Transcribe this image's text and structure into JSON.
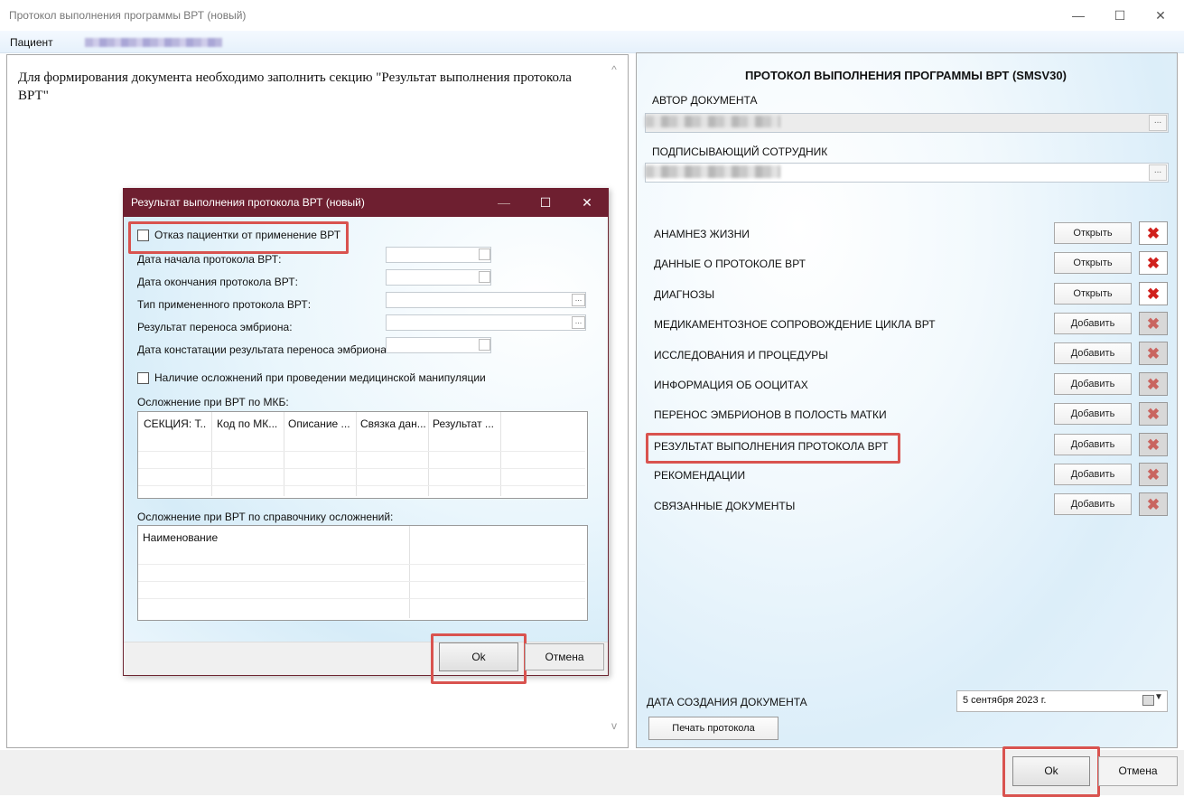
{
  "window": {
    "title": "Протокол выполнения программы ВРТ (новый)",
    "controls": {
      "minimize": "—",
      "maximize": "☐",
      "close": "✕"
    }
  },
  "patient": {
    "label": "Пациент"
  },
  "left": {
    "message": "Для формирования документа необходимо заполнить секцию \"Результат выполнения протокола ВРТ\"",
    "scroll_up": "^",
    "scroll_down": "v"
  },
  "right": {
    "doc_title": "ПРОТОКОЛ ВЫПОЛНЕНИЯ ПРОГРАММЫ ВРТ (SMSV30)",
    "author_label": "АВТОР ДОКУМЕНТА",
    "signer_label": "ПОДПИСЫВАЮЩИЙ СОТРУДНИК",
    "ellipsis": "...",
    "sections": [
      {
        "label": "АНАМНЕЗ ЖИЗНИ",
        "button": "Открыть"
      },
      {
        "label": "ДАННЫЕ О ПРОТОКОЛЕ ВРТ",
        "button": "Открыть"
      },
      {
        "label": "ДИАГНОЗЫ",
        "button": "Открыть"
      },
      {
        "label": "МЕДИКАМЕНТОЗНОЕ СОПРОВОЖДЕНИЕ ЦИКЛА ВРТ",
        "button": "Добавить"
      },
      {
        "label": "ИССЛЕДОВАНИЯ И ПРОЦЕДУРЫ",
        "button": "Добавить"
      },
      {
        "label": "ИНФОРМАЦИЯ ОБ ООЦИТАХ",
        "button": "Добавить"
      },
      {
        "label": "ПЕРЕНОС ЭМБРИОНОВ В ПОЛОСТЬ МАТКИ",
        "button": "Добавить"
      },
      {
        "label": "РЕЗУЛЬТАТ ВЫПОЛНЕНИЯ ПРОТОКОЛА ВРТ",
        "button": "Добавить"
      },
      {
        "label": "РЕКОМЕНДАЦИИ",
        "button": "Добавить"
      },
      {
        "label": "СВЯЗАННЫЕ ДОКУМЕНТЫ",
        "button": "Добавить"
      }
    ],
    "delete_icon": "✖",
    "date_label": "ДАТА СОЗДАНИЯ ДОКУМЕНТА",
    "date_value": "5 сентября 2023 г.",
    "date_arrow": "▼",
    "print_button": "Печать протокола"
  },
  "footer": {
    "ok": "Ok",
    "cancel": "Отмена"
  },
  "dialog": {
    "title": "Результат выполнения протокола ВРТ (новый)",
    "refusal_checkbox": "Отказ пациентки от применение ВРТ",
    "fields": [
      {
        "label": "Дата начала протокола ВРТ:"
      },
      {
        "label": "Дата окончания протокола ВРТ:"
      },
      {
        "label": "Тип примененного протокола ВРТ:"
      },
      {
        "label": "Результат переноса эмбриона:"
      },
      {
        "label": "Дата констатации результата переноса эмбриона:"
      }
    ],
    "complications_checkbox": "Наличие осложнений при проведении медицинской манипуляции",
    "mkb_label": "Осложнение при ВРТ по МКБ:",
    "mkb_columns": [
      "СЕКЦИЯ: Т...",
      "Код по МК...",
      "Описание ...",
      "Связка дан...",
      "Результат ..."
    ],
    "ref_label": "Осложнение при ВРТ по справочнику осложнений:",
    "ref_columns": [
      "Наименование"
    ],
    "ok": "Ok",
    "cancel": "Отмена"
  }
}
